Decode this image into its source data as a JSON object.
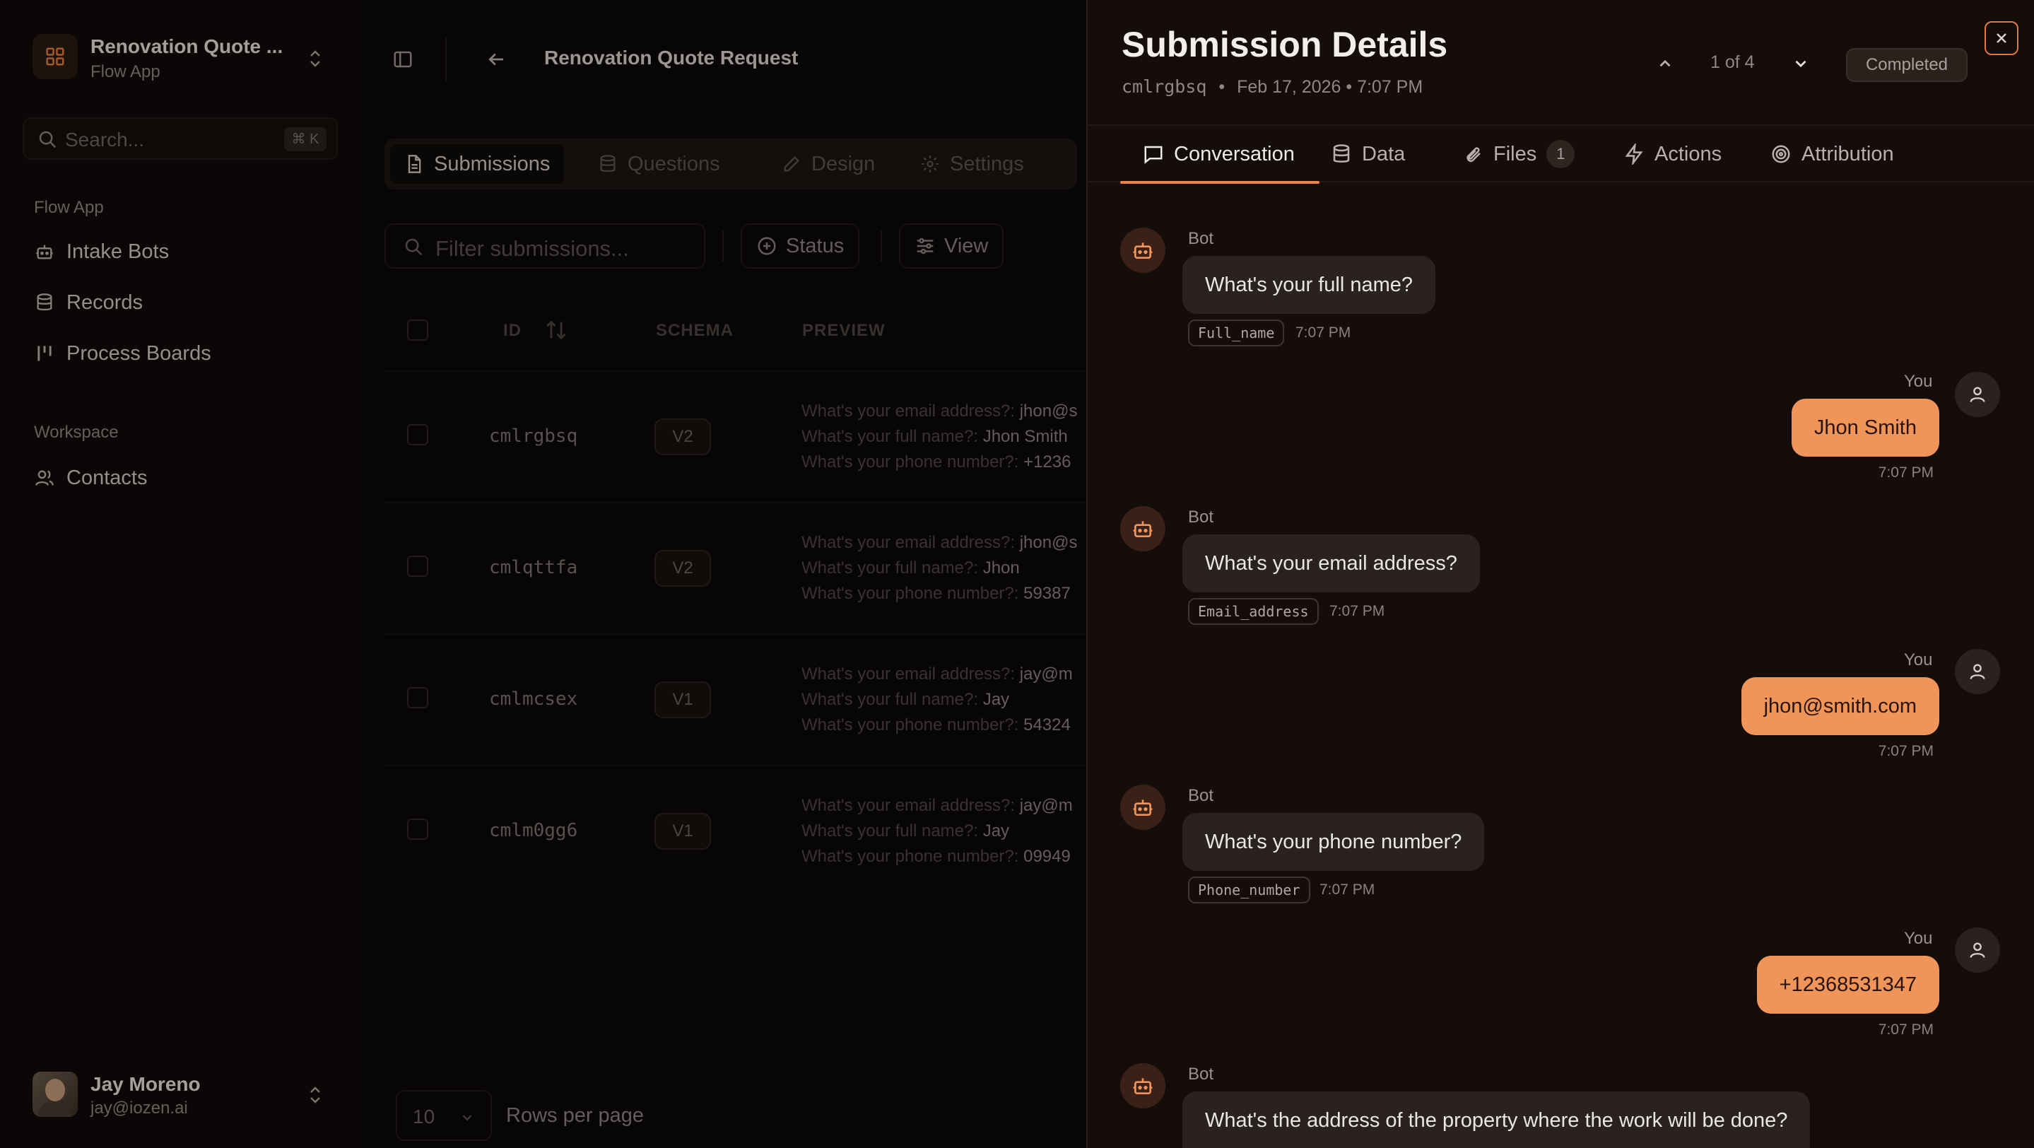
{
  "app": {
    "title": "Renovation Quote ...",
    "subtitle": "Flow App",
    "search_placeholder": "Search...",
    "search_shortcut": "⌘ K",
    "sections": {
      "flow_app": "Flow App",
      "workspace": "Workspace"
    },
    "nav": {
      "intake_bots": "Intake Bots",
      "records": "Records",
      "process_boards": "Process Boards",
      "contacts": "Contacts"
    },
    "user": {
      "name": "Jay Moreno",
      "email": "jay@iozen.ai"
    }
  },
  "main": {
    "page_title": "Renovation Quote Request",
    "tabs": {
      "submissions": "Submissions",
      "questions": "Questions",
      "design": "Design",
      "settings": "Settings"
    },
    "filter_placeholder": "Filter submissions...",
    "status_button": "Status",
    "view_button": "View",
    "columns": {
      "id": "ID",
      "schema": "SCHEMA",
      "preview": "PREVIEW"
    },
    "rows": [
      {
        "id": "cmlrgbsq",
        "schema": "V2",
        "p1_q": "What's your email address?:",
        "p1_a": "jhon@s",
        "p2_q": "What's your full name?:",
        "p2_a": "Jhon Smith",
        "p3_q": "What's your phone number?:",
        "p3_a": "+1236"
      },
      {
        "id": "cmlqttfa",
        "schema": "V2",
        "p1_q": "What's your email address?:",
        "p1_a": "jhon@s",
        "p2_q": "What's your full name?:",
        "p2_a": "Jhon",
        "p3_q": "What's your phone number?:",
        "p3_a": "59387"
      },
      {
        "id": "cmlmcsex",
        "schema": "V1",
        "p1_q": "What's your email address?:",
        "p1_a": "jay@m",
        "p2_q": "What's your full name?:",
        "p2_a": "Jay",
        "p3_q": "What's your phone number?:",
        "p3_a": "54324"
      },
      {
        "id": "cmlm0gg6",
        "schema": "V1",
        "p1_q": "What's your email address?:",
        "p1_a": "jay@m",
        "p2_q": "What's your full name?:",
        "p2_a": "Jay",
        "p3_q": "What's your phone number?:",
        "p3_a": "09949"
      }
    ],
    "rows_per_page_value": "10",
    "rows_per_page_label": "Rows per page"
  },
  "drawer": {
    "title": "Submission Details",
    "submission_id": "cmlrgbsq",
    "date": "Feb 17, 2026 • 7:07 PM",
    "bullet": "•",
    "counter": "1 of 4",
    "status": "Completed",
    "tabs": {
      "conversation": "Conversation",
      "data": "Data",
      "files": "Files",
      "files_count": "1",
      "actions": "Actions",
      "attribution": "Attribution"
    },
    "messages": [
      {
        "sender": "Bot",
        "text": "What's your full name?",
        "var": "Full_name",
        "time": "7:07 PM"
      },
      {
        "sender": "You",
        "text": "Jhon Smith",
        "time": "7:07 PM"
      },
      {
        "sender": "Bot",
        "text": "What's your email address?",
        "var": "Email_address",
        "time": "7:07 PM"
      },
      {
        "sender": "You",
        "text": "jhon@smith.com",
        "time": "7:07 PM"
      },
      {
        "sender": "Bot",
        "text": "What's your phone number?",
        "var": "Phone_number",
        "time": "7:07 PM"
      },
      {
        "sender": "You",
        "text": "+12368531347",
        "time": "7:07 PM"
      },
      {
        "sender": "Bot",
        "text": "What's the address of the property where the work will be done?"
      }
    ]
  },
  "colors": {
    "accent": "#f0955a",
    "accent_border": "#e07a3c",
    "background": "#0d0908",
    "drawer_background": "#150d0a"
  }
}
